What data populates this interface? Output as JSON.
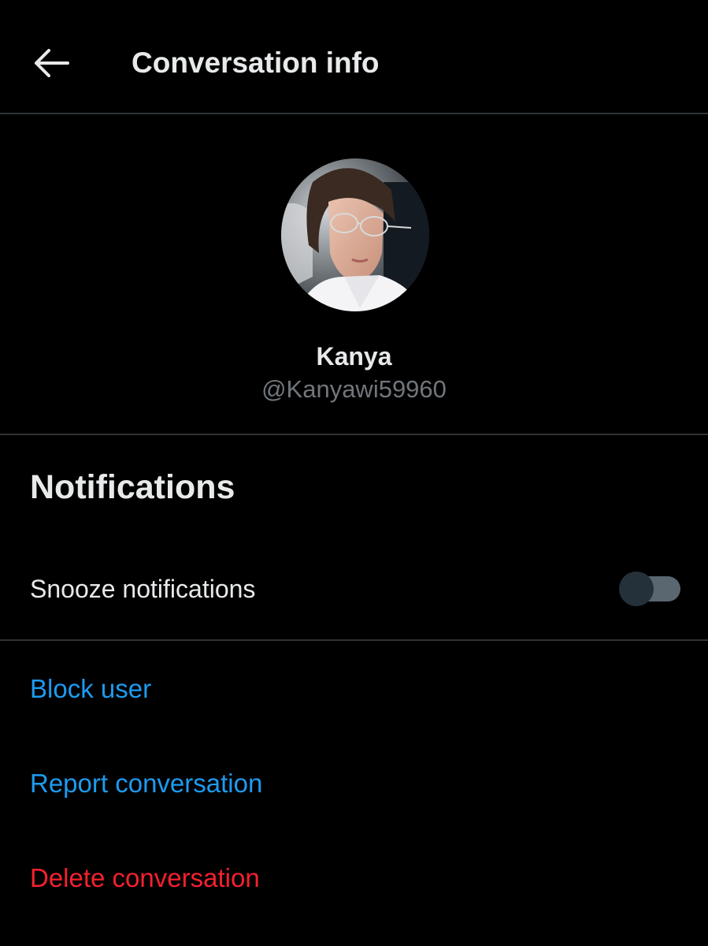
{
  "header": {
    "title": "Conversation info",
    "back_icon": "arrow-left-icon"
  },
  "profile": {
    "name": "Kanya",
    "handle": "@Kanyawi59960"
  },
  "notifications": {
    "section_title": "Notifications",
    "snooze_label": "Snooze notifications",
    "snooze_enabled": false
  },
  "actions": {
    "block_user": "Block user",
    "report_conversation": "Report conversation",
    "delete_conversation": "Delete conversation"
  },
  "colors": {
    "background": "#000000",
    "text_primary": "#e7e9ea",
    "text_secondary": "#71767b",
    "link_blue": "#1d9bf0",
    "danger_red": "#f4212e",
    "divider": "#2f3336"
  }
}
